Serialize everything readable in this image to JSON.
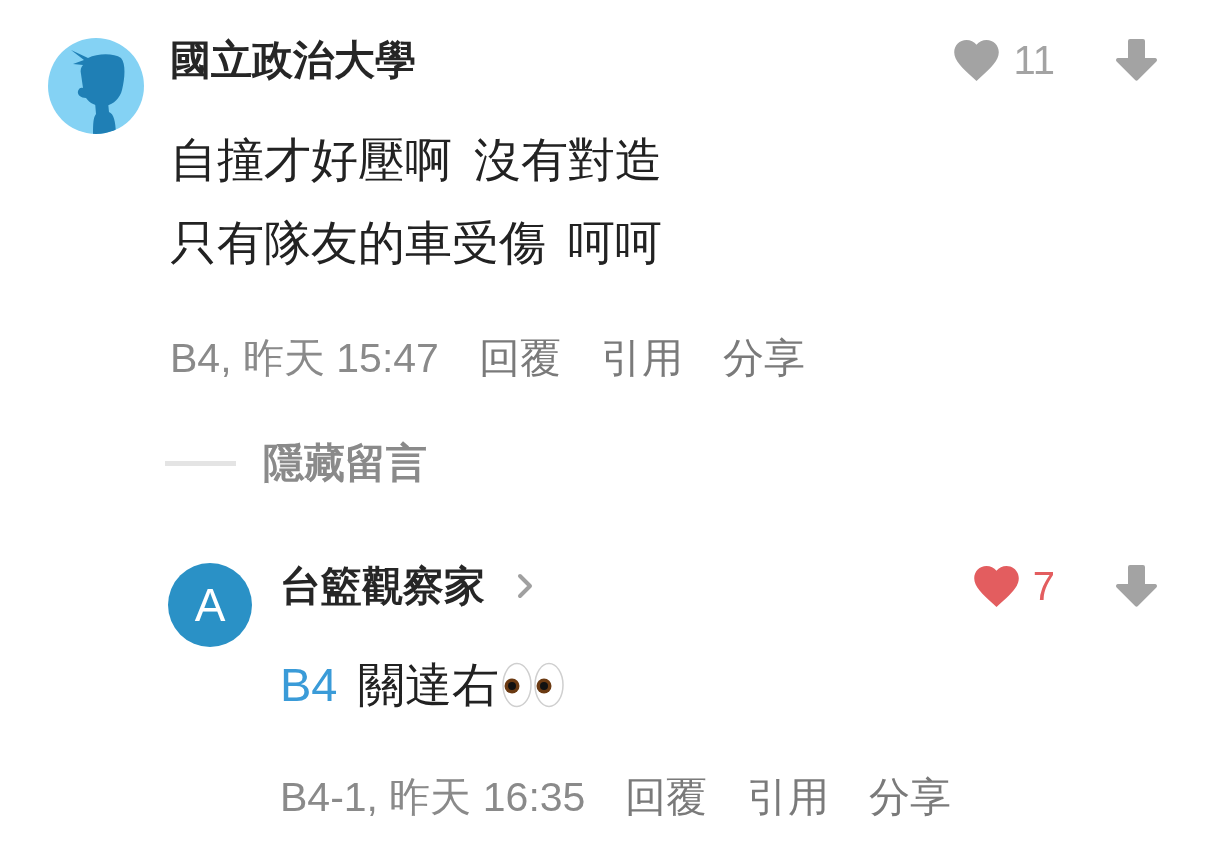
{
  "comments": [
    {
      "author": "國立政治大學",
      "avatar": {
        "kind": "silhouette"
      },
      "likes": "11",
      "liked": false,
      "body": [
        {
          "text": "自撞才好壓啊 沒有對造"
        },
        {
          "text": "只有隊友的車受傷 呵呵"
        }
      ],
      "meta": "B4, 昨天 15:47",
      "actions": [
        "回覆",
        "引用",
        "分享"
      ],
      "replies_toggle": "隱藏留言",
      "replies": [
        {
          "author": "台籃觀察家",
          "chevron": true,
          "avatar": {
            "kind": "letter",
            "letter": "A"
          },
          "likes": "7",
          "liked": true,
          "body": [
            {
              "mention": "B4",
              "text": "關達右",
              "eyes_emoji": true
            }
          ],
          "meta": "B4-1, 昨天 16:35",
          "actions": [
            "回覆",
            "引用",
            "分享"
          ]
        }
      ]
    }
  ]
}
